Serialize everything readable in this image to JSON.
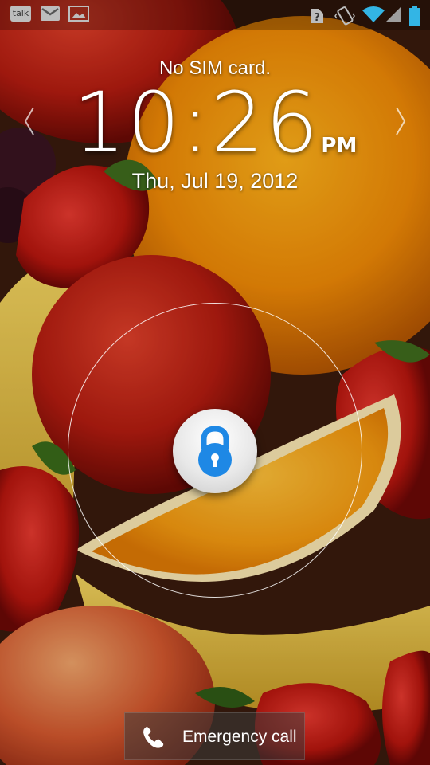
{
  "status_bar": {
    "talk_label": "talk",
    "icons": [
      "talk-icon",
      "gmail-icon",
      "gallery-icon",
      "no-sim-icon",
      "vibrate-icon",
      "wifi-icon",
      "signal-icon",
      "battery-icon"
    ],
    "accent_color": "#33b5e5"
  },
  "lockscreen": {
    "sim_status": "No SIM card.",
    "time": "10:26",
    "ampm": "PM",
    "date": "Thu, Jul 19, 2012"
  },
  "unlock": {
    "lock_color": "#1e88e5"
  },
  "emergency": {
    "label": "Emergency call"
  }
}
